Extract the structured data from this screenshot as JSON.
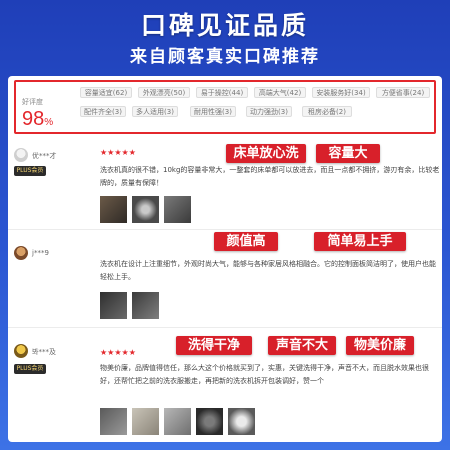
{
  "banner": {
    "title": "口碑见证品质",
    "subtitle": "来自顾客真实口碑推荐"
  },
  "rating": {
    "label": "好评度",
    "value": "98",
    "unit": "%"
  },
  "tags": [
    "容量适宜(62)",
    "外观漂亮(50)",
    "易于操控(44)",
    "高端大气(42)",
    "安装服务好(34)",
    "方便省事(24)",
    "配件齐全(3)",
    "多人适用(3)",
    "耐用性强(3)",
    "动力强劲(3)",
    "租房必备(2)"
  ],
  "reviews": [
    {
      "user": "优***才",
      "member": "PLUS会员",
      "stars": "★★★★★",
      "badges": [
        "床单放心洗",
        "容量大"
      ],
      "text": "洗衣机真的很不错，10kg的容量非常大，一整套的床单都可以放进去，而且一点都不拥挤，游刃有余，比较老牌的，质量有保障！",
      "photos": 3
    },
    {
      "user": "j***9",
      "member": "",
      "stars": "★★★★★",
      "badges": [
        "颜值高",
        "简单易上手"
      ],
      "text": "洗衣机在设计上注重细节，外观时尚大气，能够与各种家居风格相融合。它的控制面板简洁明了，使用户也能轻松上手。",
      "photos": 2
    },
    {
      "user": "봐***及",
      "member": "PLUS会员",
      "stars": "★★★★★",
      "badges": [
        "洗得干净",
        "声音不大",
        "物美价廉"
      ],
      "text": "物美价廉，品牌值得信任，那么大这个价格就买到了，实惠，关键洗得干净，声音不大，而且脱水效果也很好，还帮忙把之前的洗衣服搬走，再把新的洗衣机拆开包装调好，赞一个",
      "photos": 5
    }
  ]
}
